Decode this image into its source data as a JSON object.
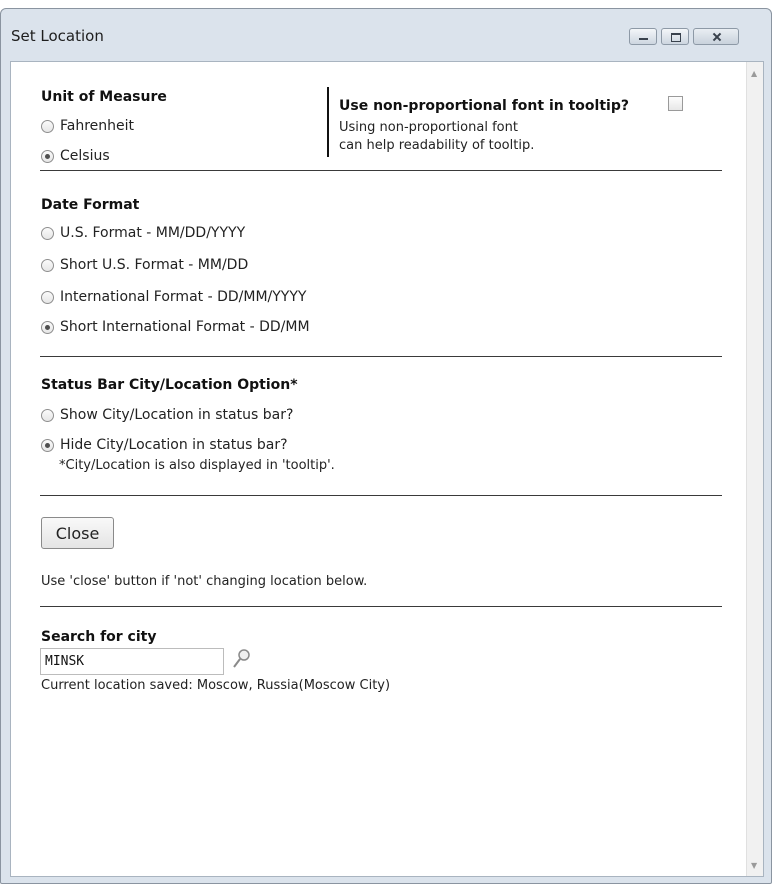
{
  "window": {
    "title": "Set Location"
  },
  "unit_of_measure": {
    "heading": "Unit of Measure",
    "options": [
      {
        "label": "Fahrenheit",
        "selected": false
      },
      {
        "label": "Celsius",
        "selected": true
      }
    ]
  },
  "tooltip_font": {
    "label": "Use non-proportional font in tooltip?",
    "checked": false,
    "help_line1": "Using non-proportional font",
    "help_line2": "can help readability of tooltip."
  },
  "date_format": {
    "heading": "Date Format",
    "options": [
      {
        "label": "U.S. Format - MM/DD/YYYY",
        "selected": false
      },
      {
        "label": "Short U.S. Format - MM/DD",
        "selected": false
      },
      {
        "label": "International Format - DD/MM/YYYY",
        "selected": false
      },
      {
        "label": "Short International Format - DD/MM",
        "selected": true
      }
    ]
  },
  "status_bar": {
    "heading": "Status Bar City/Location Option*",
    "options": [
      {
        "label": "Show City/Location in status bar?",
        "selected": false
      },
      {
        "label": "Hide City/Location in status bar?",
        "selected": true
      }
    ],
    "note": "*City/Location is also displayed in 'tooltip'."
  },
  "close": {
    "button_label": "Close",
    "hint": "Use 'close' button if 'not' changing location below."
  },
  "search": {
    "heading": "Search for city",
    "value": "MINSK",
    "current_location": "Current location saved: Moscow, Russia(Moscow City)"
  },
  "icons": {
    "window_minimize": "minimize-icon",
    "window_maximize": "maximize-icon",
    "window_close": "close-icon",
    "search": "search-icon"
  }
}
